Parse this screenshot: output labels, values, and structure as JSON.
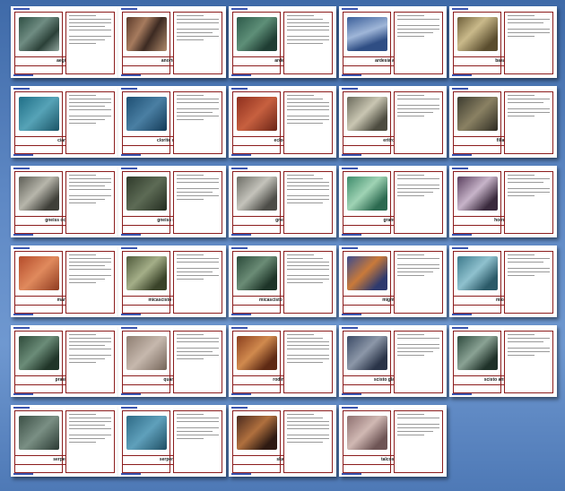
{
  "slides": [
    {
      "name": "aegirite",
      "photo": "linear-gradient(135deg,#2e4f44,#6f8c82 40%,#2b4038 70%,#8fa59c)"
    },
    {
      "name": "anortosite",
      "photo": "linear-gradient(120deg,#5b3a2a,#a67b5e 35%,#3c2a22 60%,#b08a6b)"
    },
    {
      "name": "ardesia",
      "photo": "linear-gradient(135deg,#2d5a4a,#5e8f78 45%,#1f3d33 80%)"
    },
    {
      "name": "ardesia argentea",
      "photo": "linear-gradient(160deg,#3b5f9a,#9fb6d8 45%,#2f4e84 75%)"
    },
    {
      "name": "basalto",
      "photo": "linear-gradient(135deg,#6e5f3a,#c9b98a 40%,#5a4d2e 80%)"
    },
    {
      "name": "cianite",
      "photo": "linear-gradient(135deg,#1f6e86,#56a3b7 50%,#1a5466)"
    },
    {
      "name": "clorite schisto",
      "photo": "linear-gradient(135deg,#1e4f73,#4a7fa3 50%,#143b58)"
    },
    {
      "name": "eclogite",
      "photo": "linear-gradient(135deg,#8e2f1e,#c7603f 50%,#6b2416)"
    },
    {
      "name": "eritrosite",
      "photo": "linear-gradient(135deg,#6b6a5c,#c9c6b2 45%,#4d4c40 80%)"
    },
    {
      "name": "fillade",
      "photo": "linear-gradient(135deg,#3c3b2f,#8a8163 50%,#2e2c22)"
    },
    {
      "name": "gneiss occhiadino",
      "photo": "linear-gradient(135deg,#5d5d55,#b7b6ab 45%,#3f3f39 80%)"
    },
    {
      "name": "gneiss minute",
      "photo": "linear-gradient(135deg,#2f3a2b,#5d6b55 50%,#232c20)"
    },
    {
      "name": "gneiss",
      "photo": "linear-gradient(135deg,#6d6d66,#c4c3bb 45%,#4d4d48 80%)"
    },
    {
      "name": "granulite",
      "photo": "linear-gradient(135deg,#3e8c6c,#9fd3b4 45%,#2c6a50 80%)"
    },
    {
      "name": "hornfels",
      "photo": "linear-gradient(135deg,#5a3f5e,#c7b4c9 45%,#3a2a3d 80%)"
    },
    {
      "name": "marmo",
      "photo": "linear-gradient(135deg,#b44b2a,#e08a5d 50%,#8e3a1f)"
    },
    {
      "name": "micascisto granatifero",
      "photo": "linear-gradient(135deg,#4f5a3c,#a4ae88 45%,#3a4329 80%)"
    },
    {
      "name": "micascisto muscovite",
      "photo": "linear-gradient(135deg,#2b4a3a,#6b8c76 45%,#1d3428 80%)"
    },
    {
      "name": "migmatite",
      "photo": "linear-gradient(135deg,#3b4b8e,#c97a3a 45%,#2e3a6e 80%)"
    },
    {
      "name": "miolite",
      "photo": "linear-gradient(135deg,#3d7a8c,#8fc1ce 45%,#2b5a68 80%)"
    },
    {
      "name": "prasinite",
      "photo": "linear-gradient(135deg,#2e4a3a,#6b8c78 45%,#203528 80%)"
    },
    {
      "name": "quarzite",
      "photo": "linear-gradient(135deg,#8e7e72,#c6b8ad 50%,#746559)"
    },
    {
      "name": "rodingite",
      "photo": "linear-gradient(135deg,#8a3f1e,#d18a4e 45%,#5e2a14 80%)"
    },
    {
      "name": "scisto glaucofane",
      "photo": "linear-gradient(135deg,#3b4a66,#8c97a8 45%,#2a3448 80%)"
    },
    {
      "name": "scisto anfibolitico",
      "photo": "linear-gradient(135deg,#2e4a3e,#8aa294 45%,#1f3229 80%)"
    },
    {
      "name": "serpentino",
      "photo": "linear-gradient(135deg,#3b4f45,#7a8f84 50%,#2a3a32)"
    },
    {
      "name": "serpentinite",
      "photo": "linear-gradient(135deg,#2e6a86,#5fa0bb 50%,#1f4e63)"
    },
    {
      "name": "skarn",
      "photo": "linear-gradient(135deg,#4a2a1e,#b0703e 45%,#2e1a12 80%)"
    },
    {
      "name": "talcoscisto",
      "photo": "linear-gradient(135deg,#8e7070,#d0b8b3 45%,#6e5555 80%)"
    }
  ]
}
